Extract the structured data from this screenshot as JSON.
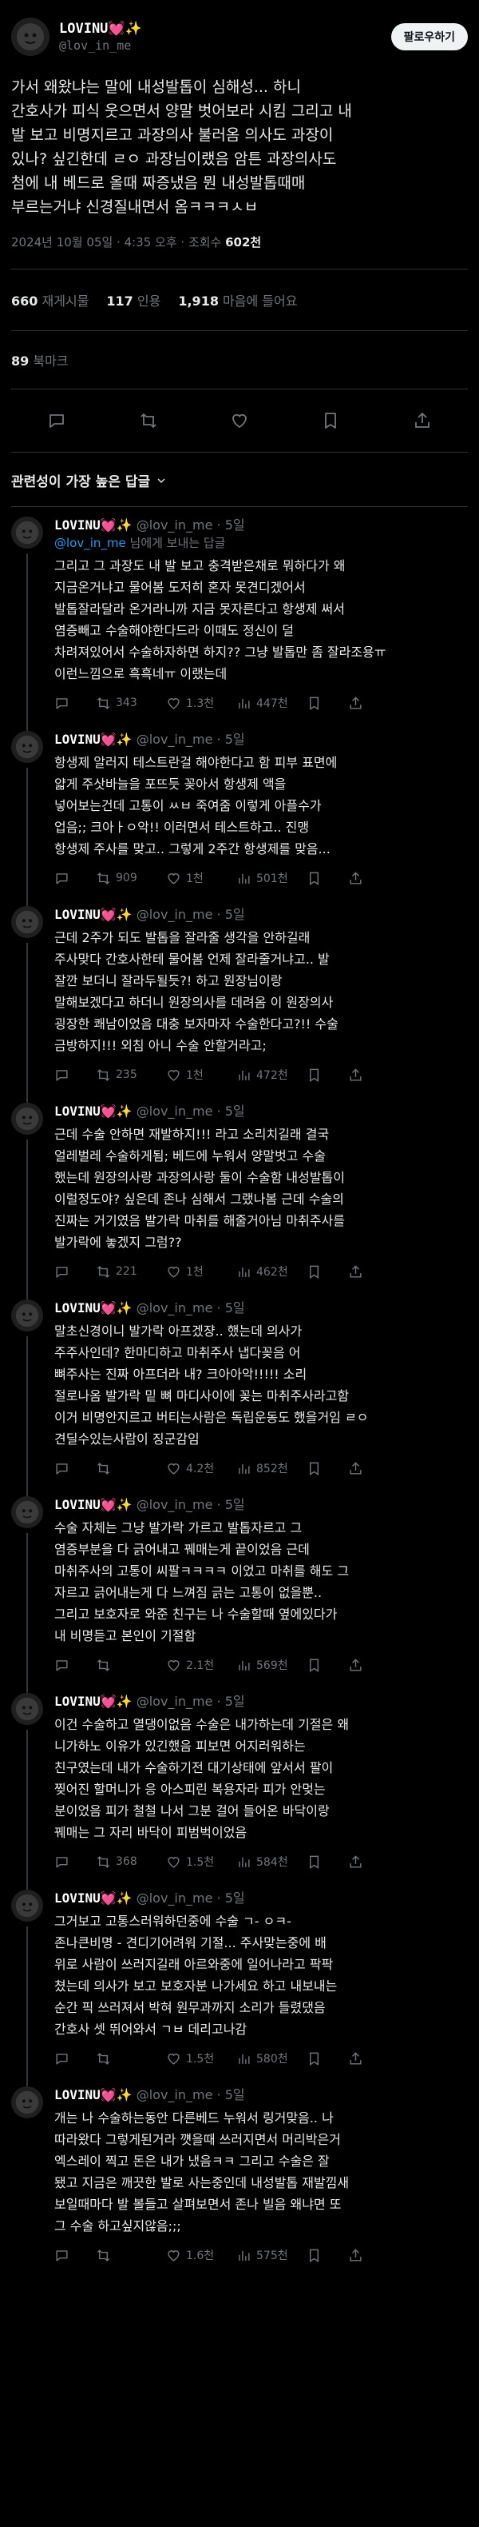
{
  "post": {
    "display_name": "LOVINU💓✨",
    "handle": "@lov_in_me",
    "follow_label": "팔로우하기",
    "lines": [
      "가서 왜왔냐는 말에 내성발톱이 심해성... 하니",
      "간호사가 피식 웃으면서 양말 벗어보라 시킴 그리고 내",
      "발 보고 비명지르고 과장의사 불러옴 의사도 과장이",
      "있나? 싶긴한데 ㄹㅇ 과장님이랬음 암튼 과장의사도",
      "첨에 내 베드로 올때 짜증냈음 뭔 내성발톱때매",
      "부르는거냐 신경질내면서 옴ㅋㅋㅋㅅㅂ"
    ],
    "timestamp": "2024년 10월 05일 · 4:35 오후 · 조회수 ",
    "views": "602천",
    "reposts_num": "660",
    "reposts_label": "재게시물",
    "quotes_num": "117",
    "quotes_label": "인용",
    "likes_num": "1,918",
    "likes_label": "마음에 들어요",
    "bookmarks_num": "89",
    "bookmarks_label": "북마크",
    "sort_label": "관련성이 가장 높은 답글"
  },
  "replies": [
    {
      "name": "LOVINU💓✨",
      "meta": " @lov_in_me · 5일",
      "replyto_prefix": "",
      "replyto_handle": "@lov_in_me",
      "replyto_suffix": " 님에게 보내는 답글",
      "lines": [
        "그리고 그 과장도 내 발 보고 충격받은채로 뭐하다가 왜",
        "지금온거냐고 물어봄 도저히 혼자 못견디겠어서",
        "발톱잘라달라 온거라니까 지금 못자른다고 항생제 써서",
        "염증빼고 수술해야한다드라 이때도 정신이 덜",
        "차려져있어서 수술하자하면 하지?? 그냥 발톱만 좀 잘라조용ㅠ",
        "이런느낌으로 흑흑네ㅠ 이랬는데"
      ],
      "replies": "",
      "reposts": "343",
      "likes": "1.3천",
      "views": "447천"
    },
    {
      "name": "LOVINU💓✨",
      "meta": " @lov_in_me · 5일",
      "lines": [
        "항생제 알러지 테스트란걸 해야한다고 함 피부 표면에",
        "얇게 주삿바늘을 포뜨듯 꽂아서 항생제 액을",
        "넣어보는건데 고통이 ㅆㅂ 죽여줌 이렇게 아플수가",
        "업음;; 크아ㅏㅇ악!! 이러면서 테스트하고.. 진맹",
        "항생제 주사를 맞고.. 그렇게 2주간 항생제를 맞음..."
      ],
      "replies": "",
      "reposts": "909",
      "likes": "1천",
      "views": "501천"
    },
    {
      "name": "LOVINU💓✨",
      "meta": " @lov_in_me · 5일",
      "lines": [
        "근데 2주가 되도 발톱을 잘라줄 생각을 안하길래",
        "주사맞다 간호사한테 물어봄 언제 잘라줄거냐고.. 발",
        "잘깐 보더니 잘라두될듯?! 하고 원장님이랑",
        "말해보겠다고 하더니 원장의사를 데려옴 이 원장의사",
        "굉장한 쾌남이었음 대충 보자마자 수술한다고?!! 수술",
        "금방하지!!! 외침 아니 수술 안할거라고;"
      ],
      "replies": "",
      "reposts": "235",
      "likes": "1천",
      "views": "472천"
    },
    {
      "name": "LOVINU💓✨",
      "meta": " @lov_in_me · 5일",
      "lines": [
        "근데 수술 안하면 재발하지!!! 라고 소리치길래 결국",
        "얼레벌레 수술하게됨; 베드에 누워서 양말벗고 수술",
        "했는데 원장의사랑 과장의사랑 둘이 수술함 내성발톱이",
        "이럴정도야? 싶은데 존나 심해서 그랬나봄 근데 수술의",
        "진짜는 거기였음 발가락 마취를 해줄거아님 마취주사를",
        "발가락에 놓겠지 그럼??"
      ],
      "replies": "",
      "reposts": "221",
      "likes": "1천",
      "views": "462천"
    },
    {
      "name": "LOVINU💓✨",
      "meta": " @lov_in_me · 5일",
      "lines": [
        "말초신경이니 발가락 아프겠쟝.. 했는데 의사가",
        "주주사인데? 한마디하고 마취주사 냅다꽂음 어",
        "뼈주사는 진짜 아프더라 내? 크아아악!!!!! 소리",
        "절로나옴 발가락 밑 뼈 마디사이에 꽂는 마취주사라고함",
        "이거 비명안지르고 버티는사람은 독립운동도 했을거임 ㄹㅇ",
        "견딜수있는사람이 징군감임"
      ],
      "replies": "",
      "reposts": "",
      "likes": "4.2천",
      "views": "852천"
    },
    {
      "name": "LOVINU💓✨",
      "meta": " @lov_in_me · 5일",
      "lines": [
        "수술 자체는 그냥 발가락 가르고 발톱자르고 그",
        "염증부분을 다 긁어내고 꿰매는게 끝이었음 근데",
        "마취주사의 고통이 씨팔ㅋㅋㅋㅋ 이었고 마취를 해도 그",
        "자르고 긁어내는게 다 느껴짐 긁는 고통이 없을뿐..",
        "그리고 보호자로 와준 친구는 나 수술할때 옆에있다가",
        "내 비명듣고 본인이 기절함"
      ],
      "replies": "",
      "reposts": "",
      "likes": "2.1천",
      "views": "569천"
    },
    {
      "name": "LOVINU💓✨",
      "meta": " @lov_in_me · 5일",
      "lines": [
        "이건 수술하고 열댕이없음 수술은 내가하는데 기절은 왜",
        "니가하노 이유가 있긴했음 피보면 어지러워하는",
        "친구였는데 내가 수술하기전 대기상태에 앞서서 팔이",
        "찢어진 할머니가 응 아스피린 복용자라 피가 안멎는",
        "분이었음 피가 철철 나서 그분 걸어 들어온 바닥이랑",
        "꿰매는 그 자리 바닥이 피범벅이었음"
      ],
      "replies": "",
      "reposts": "368",
      "likes": "1.5천",
      "views": "584천"
    },
    {
      "name": "LOVINU💓✨",
      "meta": " @lov_in_me · 5일",
      "lines": [
        "그거보고 고통스러워하던중에 수술 ㄱ- ㅇㅋ-",
        "존나큰비명 - 견디기어려워 기절... 주사맞는중에 배",
        "위로 사람이 쓰러지길래 아르와중에 일어나라고 팍팍",
        "쳤는데 의사가 보고 보호자분 나가세요 하고 내보내는",
        "순간 픽 쓰러져서 박혀 원무과까지 소리가 들렸댔음",
        "간호사 셋 뛰어와서 ㄱㅂ 데리고나감"
      ],
      "replies": "",
      "reposts": "",
      "likes": "1.5천",
      "views": "580천"
    },
    {
      "name": "LOVINU💓✨",
      "meta": " @lov_in_me · 5일",
      "lines": [
        "개는 나 수술하는동안 다른베드 누워서 링거맞음.. 나",
        "따라왔다 그렇게된거라 꺳을때 쓰러지면서 머리박은거",
        "엑스레이 찍고 돈은 내가 냈음ㅋㅋ 그리고 수술은 잘",
        "됐고 지금은 깨끗한 발로 사는중인데 내성발톱 재발낌새",
        "보일때마다 발 볼들고 살펴보면서 존나 빌음 왜냐면 또",
        "그 수술 하고싶지않음;;;"
      ],
      "replies": "",
      "reposts": "",
      "likes": "1.6천",
      "views": "575천"
    }
  ],
  "icons": {
    "reply": "reply-bubble-icon",
    "repost": "repost-arrows-icon",
    "like": "heart-icon",
    "views": "bar-chart-icon",
    "bookmark": "bookmark-icon",
    "share": "share-icon"
  },
  "colors": {
    "background": "#000000",
    "text": "#e7e9ea",
    "muted": "#71767b",
    "link": "#1d9bf0",
    "border": "#2f3336"
  }
}
